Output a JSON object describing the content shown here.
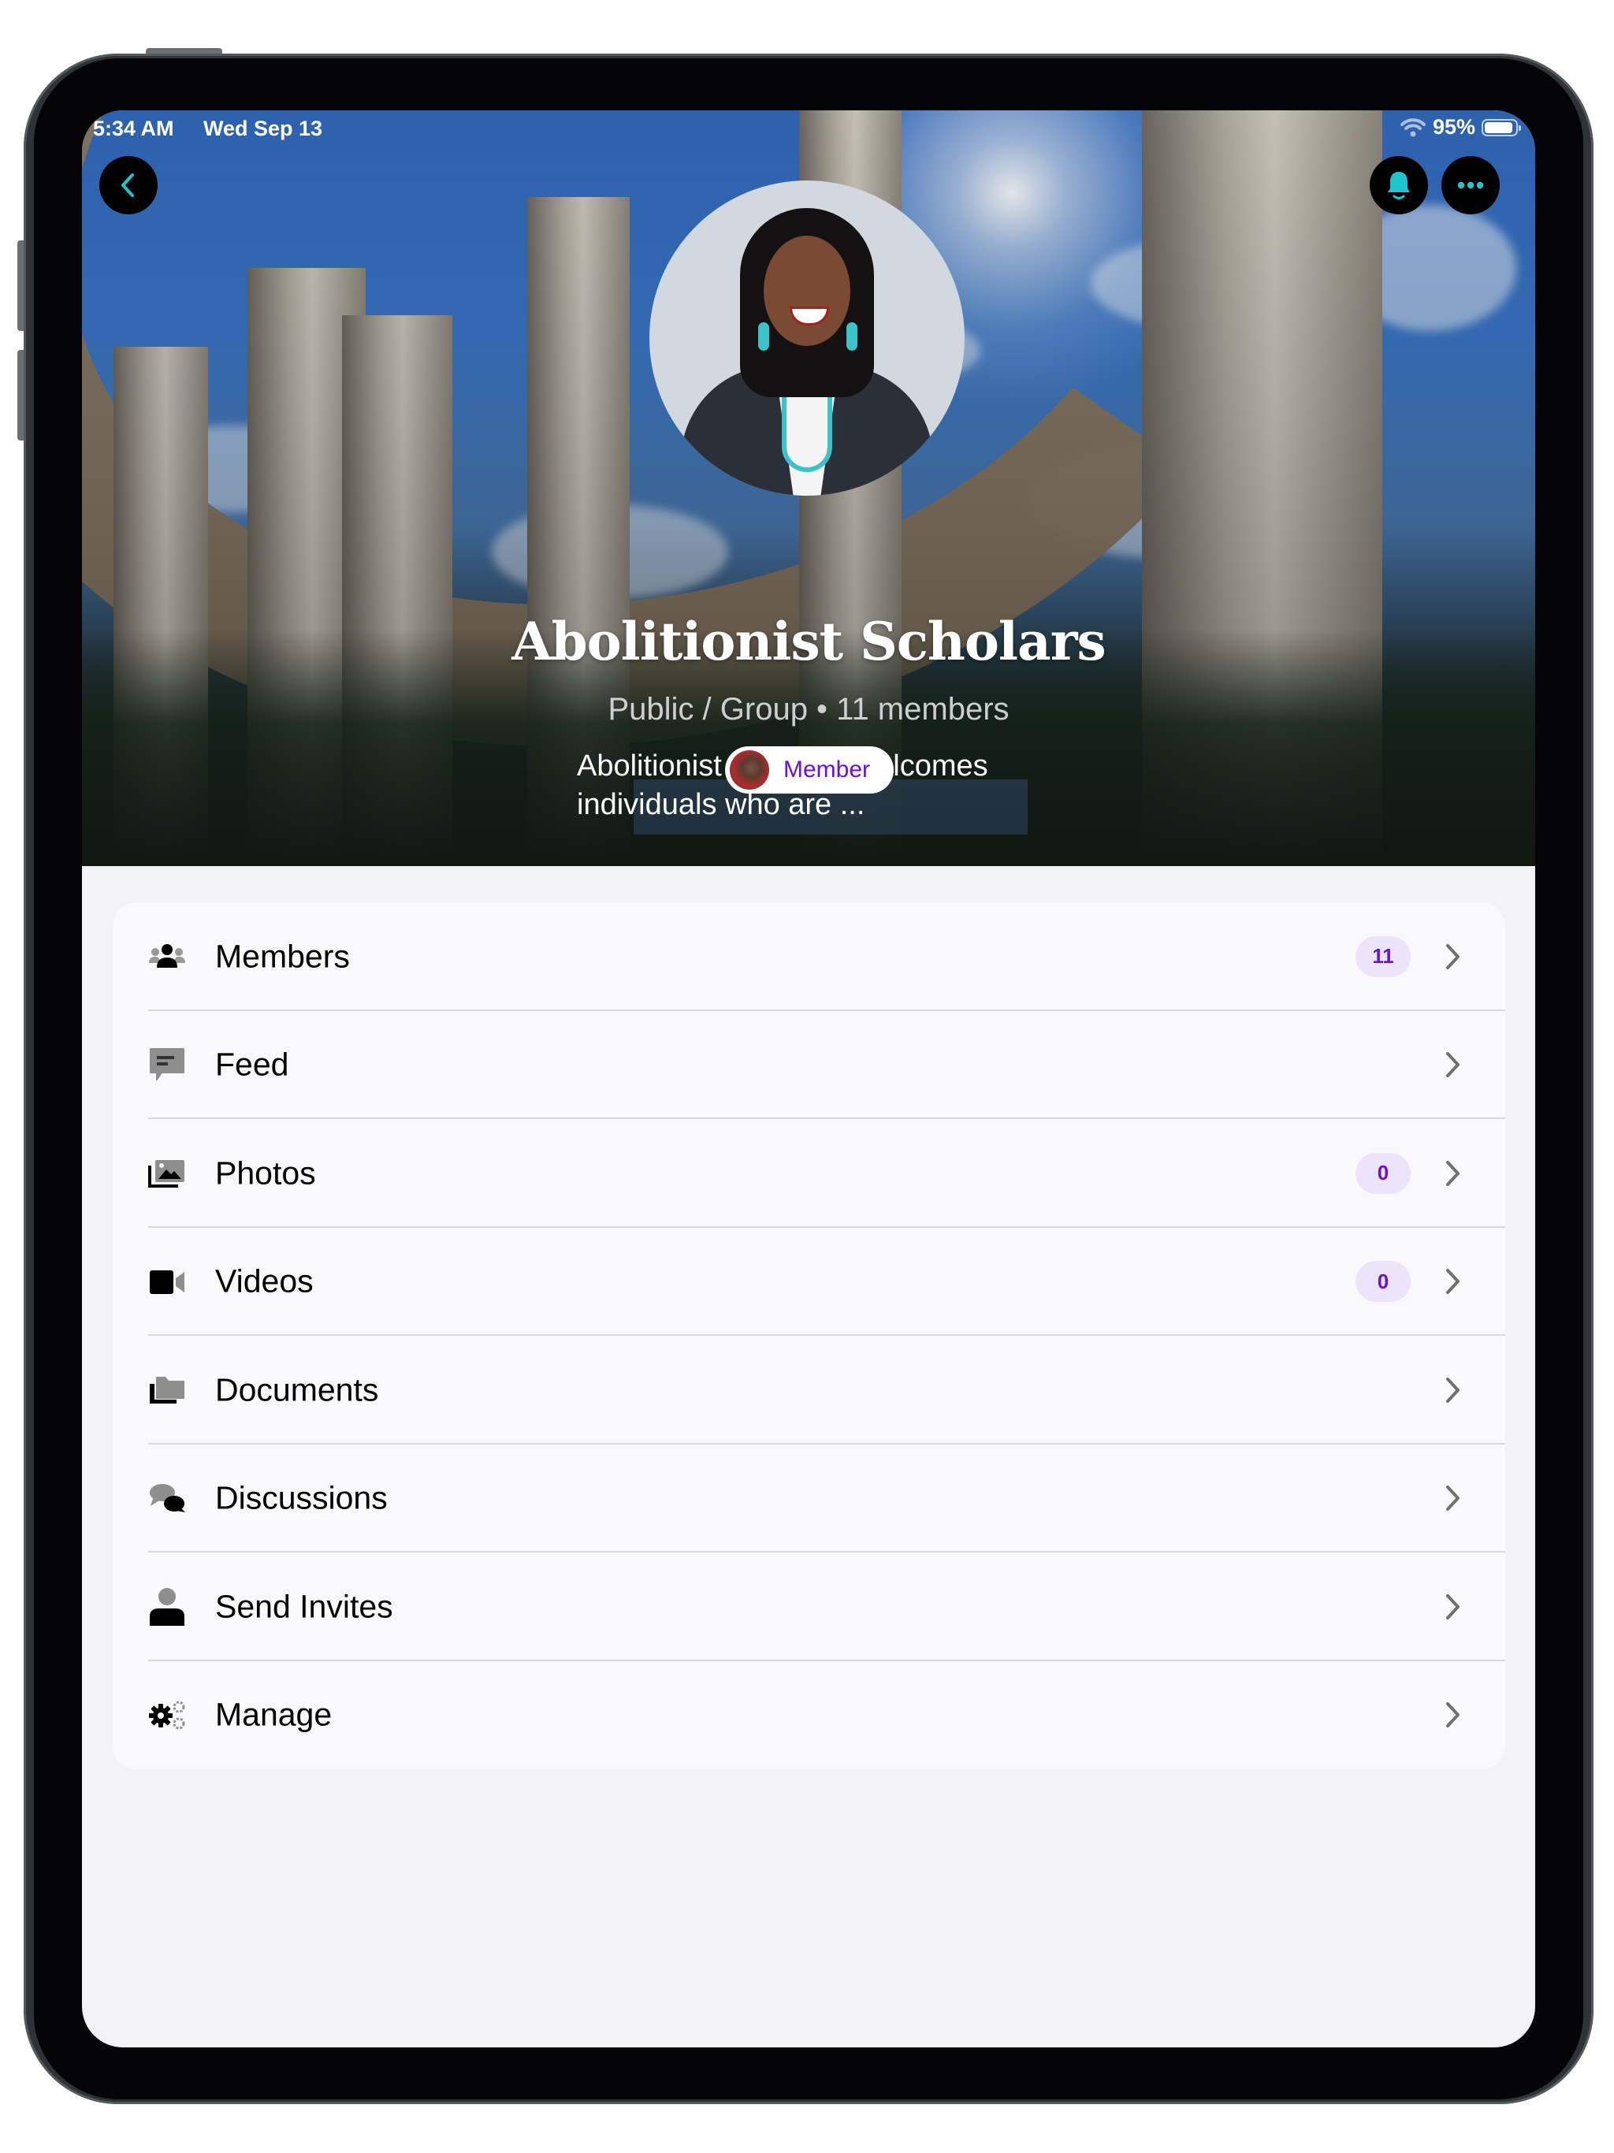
{
  "status_bar": {
    "time": "5:34 AM",
    "date": "Wed Sep 13",
    "battery": "95%",
    "battery_level": 0.95
  },
  "header": {
    "back_icon": "chevron-left-icon",
    "notifications_icon": "bell-icon",
    "more_icon": "ellipsis-icon",
    "accent_color": "#1cc6cc"
  },
  "group": {
    "name": "Abolitionist Scholars",
    "meta": "Public / Group • 11 members",
    "description": "Abolitionist Scholars welcomes individuals who are ...",
    "membership_label": "Member",
    "membership_color": "#6a11d8"
  },
  "menu": {
    "badge_color": "#6a11d8",
    "badge_bg": "#ece4fb",
    "items": [
      {
        "label": "Members",
        "icon": "members-icon",
        "badge": "11"
      },
      {
        "label": "Feed",
        "icon": "feed-icon",
        "badge": null
      },
      {
        "label": "Photos",
        "icon": "photos-icon",
        "badge": "0"
      },
      {
        "label": "Videos",
        "icon": "videos-icon",
        "badge": "0"
      },
      {
        "label": "Documents",
        "icon": "documents-icon",
        "badge": null
      },
      {
        "label": "Discussions",
        "icon": "discussions-icon",
        "badge": null
      },
      {
        "label": "Send Invites",
        "icon": "send-invites-icon",
        "badge": null
      },
      {
        "label": "Manage",
        "icon": "manage-icon",
        "badge": null
      }
    ]
  }
}
